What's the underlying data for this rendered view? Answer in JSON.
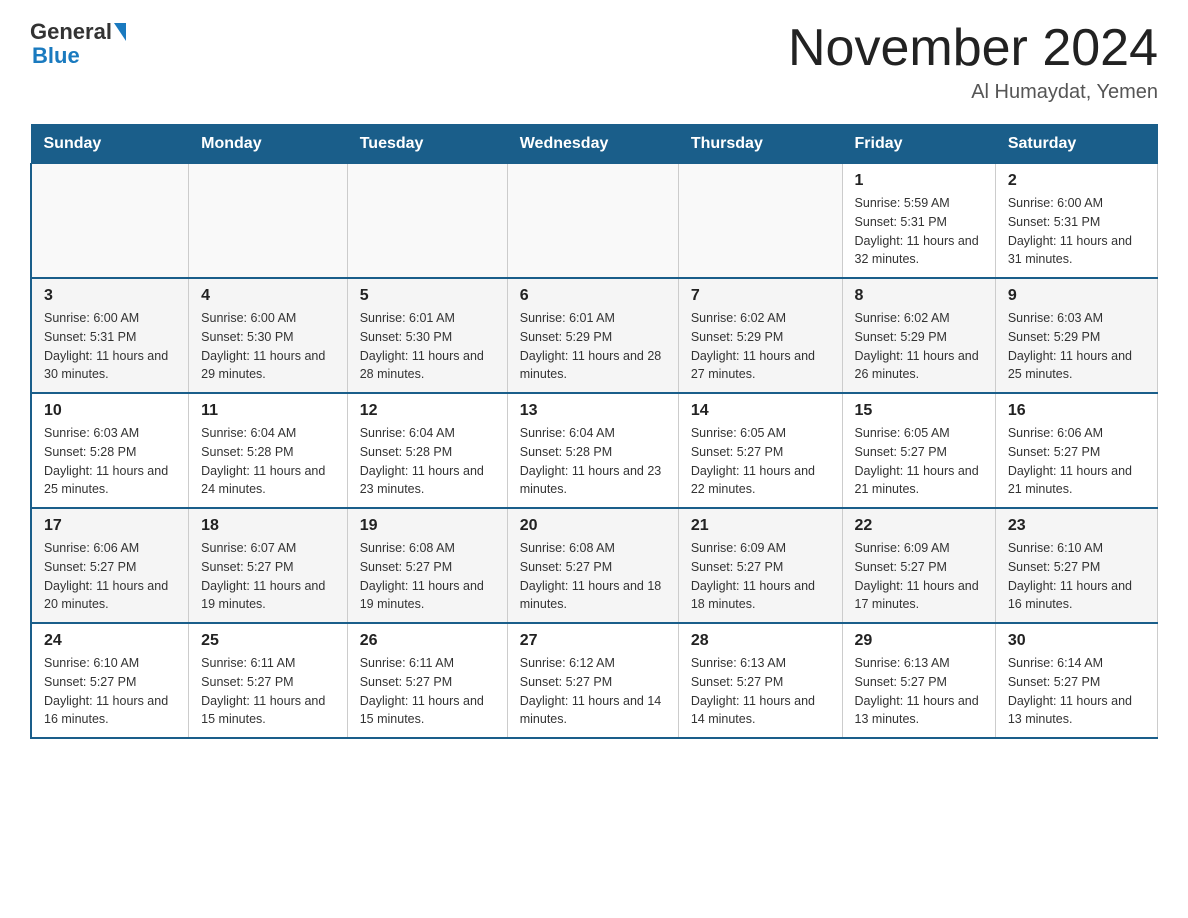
{
  "header": {
    "logo_text1": "General",
    "logo_text2": "Blue",
    "month_title": "November 2024",
    "location": "Al Humaydat, Yemen"
  },
  "days_of_week": [
    "Sunday",
    "Monday",
    "Tuesday",
    "Wednesday",
    "Thursday",
    "Friday",
    "Saturday"
  ],
  "weeks": [
    [
      {
        "day": "",
        "info": ""
      },
      {
        "day": "",
        "info": ""
      },
      {
        "day": "",
        "info": ""
      },
      {
        "day": "",
        "info": ""
      },
      {
        "day": "",
        "info": ""
      },
      {
        "day": "1",
        "info": "Sunrise: 5:59 AM\nSunset: 5:31 PM\nDaylight: 11 hours and 32 minutes."
      },
      {
        "day": "2",
        "info": "Sunrise: 6:00 AM\nSunset: 5:31 PM\nDaylight: 11 hours and 31 minutes."
      }
    ],
    [
      {
        "day": "3",
        "info": "Sunrise: 6:00 AM\nSunset: 5:31 PM\nDaylight: 11 hours and 30 minutes."
      },
      {
        "day": "4",
        "info": "Sunrise: 6:00 AM\nSunset: 5:30 PM\nDaylight: 11 hours and 29 minutes."
      },
      {
        "day": "5",
        "info": "Sunrise: 6:01 AM\nSunset: 5:30 PM\nDaylight: 11 hours and 28 minutes."
      },
      {
        "day": "6",
        "info": "Sunrise: 6:01 AM\nSunset: 5:29 PM\nDaylight: 11 hours and 28 minutes."
      },
      {
        "day": "7",
        "info": "Sunrise: 6:02 AM\nSunset: 5:29 PM\nDaylight: 11 hours and 27 minutes."
      },
      {
        "day": "8",
        "info": "Sunrise: 6:02 AM\nSunset: 5:29 PM\nDaylight: 11 hours and 26 minutes."
      },
      {
        "day": "9",
        "info": "Sunrise: 6:03 AM\nSunset: 5:29 PM\nDaylight: 11 hours and 25 minutes."
      }
    ],
    [
      {
        "day": "10",
        "info": "Sunrise: 6:03 AM\nSunset: 5:28 PM\nDaylight: 11 hours and 25 minutes."
      },
      {
        "day": "11",
        "info": "Sunrise: 6:04 AM\nSunset: 5:28 PM\nDaylight: 11 hours and 24 minutes."
      },
      {
        "day": "12",
        "info": "Sunrise: 6:04 AM\nSunset: 5:28 PM\nDaylight: 11 hours and 23 minutes."
      },
      {
        "day": "13",
        "info": "Sunrise: 6:04 AM\nSunset: 5:28 PM\nDaylight: 11 hours and 23 minutes."
      },
      {
        "day": "14",
        "info": "Sunrise: 6:05 AM\nSunset: 5:27 PM\nDaylight: 11 hours and 22 minutes."
      },
      {
        "day": "15",
        "info": "Sunrise: 6:05 AM\nSunset: 5:27 PM\nDaylight: 11 hours and 21 minutes."
      },
      {
        "day": "16",
        "info": "Sunrise: 6:06 AM\nSunset: 5:27 PM\nDaylight: 11 hours and 21 minutes."
      }
    ],
    [
      {
        "day": "17",
        "info": "Sunrise: 6:06 AM\nSunset: 5:27 PM\nDaylight: 11 hours and 20 minutes."
      },
      {
        "day": "18",
        "info": "Sunrise: 6:07 AM\nSunset: 5:27 PM\nDaylight: 11 hours and 19 minutes."
      },
      {
        "day": "19",
        "info": "Sunrise: 6:08 AM\nSunset: 5:27 PM\nDaylight: 11 hours and 19 minutes."
      },
      {
        "day": "20",
        "info": "Sunrise: 6:08 AM\nSunset: 5:27 PM\nDaylight: 11 hours and 18 minutes."
      },
      {
        "day": "21",
        "info": "Sunrise: 6:09 AM\nSunset: 5:27 PM\nDaylight: 11 hours and 18 minutes."
      },
      {
        "day": "22",
        "info": "Sunrise: 6:09 AM\nSunset: 5:27 PM\nDaylight: 11 hours and 17 minutes."
      },
      {
        "day": "23",
        "info": "Sunrise: 6:10 AM\nSunset: 5:27 PM\nDaylight: 11 hours and 16 minutes."
      }
    ],
    [
      {
        "day": "24",
        "info": "Sunrise: 6:10 AM\nSunset: 5:27 PM\nDaylight: 11 hours and 16 minutes."
      },
      {
        "day": "25",
        "info": "Sunrise: 6:11 AM\nSunset: 5:27 PM\nDaylight: 11 hours and 15 minutes."
      },
      {
        "day": "26",
        "info": "Sunrise: 6:11 AM\nSunset: 5:27 PM\nDaylight: 11 hours and 15 minutes."
      },
      {
        "day": "27",
        "info": "Sunrise: 6:12 AM\nSunset: 5:27 PM\nDaylight: 11 hours and 14 minutes."
      },
      {
        "day": "28",
        "info": "Sunrise: 6:13 AM\nSunset: 5:27 PM\nDaylight: 11 hours and 14 minutes."
      },
      {
        "day": "29",
        "info": "Sunrise: 6:13 AM\nSunset: 5:27 PM\nDaylight: 11 hours and 13 minutes."
      },
      {
        "day": "30",
        "info": "Sunrise: 6:14 AM\nSunset: 5:27 PM\nDaylight: 11 hours and 13 minutes."
      }
    ]
  ]
}
